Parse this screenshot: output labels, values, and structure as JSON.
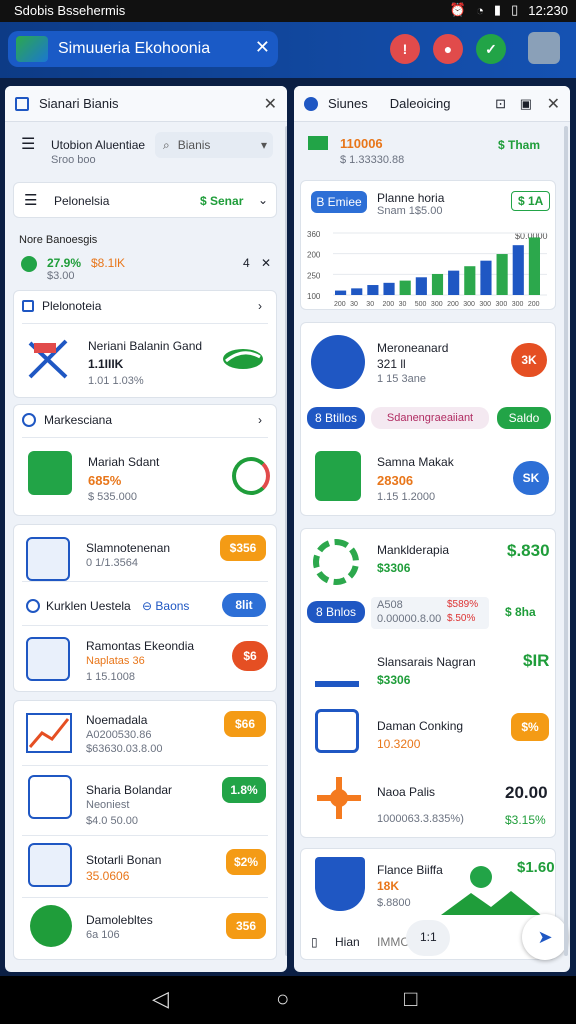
{
  "status": {
    "left": "Sdobis Bssehermis",
    "time": "12:230"
  },
  "appbar": {
    "title": "Simuueria Ekohoonia",
    "close": "✕"
  },
  "left": {
    "header": "Sianari Bianis",
    "row1": {
      "title": "Utobion Aluentiae",
      "sub": "Sroo boo",
      "search_placeholder": "Bianis"
    },
    "row2": {
      "title": "Pelonelsia",
      "value": "$ Senar"
    },
    "row3": {
      "title": "Nore Banoesgis",
      "pct": "27.9%",
      "sub1": "$3.00",
      "sub2": "$8.1lK",
      "right": "4"
    },
    "section1": {
      "title": "Plelonoteia",
      "item_title": "Neriani Balanin Gand",
      "item_value": "1.1IIIK",
      "item_sub": "1.01 1.03%"
    },
    "section2": {
      "title": "Markesciana",
      "item_title": "Mariah Sdant",
      "item_value": "685%",
      "item_sub": "$ 535.000"
    },
    "list": [
      {
        "title": "Slamnotenenan",
        "sub": "0 1/1.3564",
        "badge": "$356"
      },
      {
        "title": "Kurklen Uestela",
        "action": "Baons",
        "btn": "8lit"
      },
      {
        "title": "Ramontas Ekeondia",
        "sub": "Naplatas 36",
        "sub2": "1 15.1008",
        "badge": "$6"
      },
      {
        "title": "Noemadala",
        "sub": "A0200530.86",
        "sub2": "$63630.03.8.00",
        "badge": "$66"
      },
      {
        "title": "Sharia Bolandar",
        "sub": "Neoniest",
        "sub2": "$4.0 50.00",
        "badge": "1.8%"
      },
      {
        "title": "Stotarli Bonan",
        "sub": "35.0606",
        "badge": "$2%"
      },
      {
        "title": "Damolebltes",
        "sub": "6a 106",
        "badge": "356"
      }
    ]
  },
  "right": {
    "header1": "Siunes",
    "header2": "Daleoicing",
    "top": {
      "value": "110006",
      "sub": "$ 1.33330.88",
      "right": "$ Tham"
    },
    "chart": {
      "btn": "B Emiee",
      "title": "Planne horia",
      "sub": "Snam 1$5.00",
      "right": "$ 1A",
      "corner": "$0.0000"
    },
    "chart_data": {
      "type": "bar",
      "categories": [
        "200",
        "30",
        "30",
        "200",
        "30",
        "500",
        "300",
        "200",
        "300",
        "300",
        "300",
        "300",
        "200"
      ],
      "values": [
        20,
        30,
        45,
        55,
        65,
        80,
        95,
        110,
        130,
        155,
        185,
        225,
        260
      ],
      "ylabels": [
        "360",
        "200",
        "250",
        "100"
      ],
      "colors": [
        "#1f57c3",
        "#1f57c3",
        "#1f57c3",
        "#1f57c3",
        "#2ca84c",
        "#1f57c3",
        "#2ca84c",
        "#1f57c3",
        "#2ca84c",
        "#1f57c3",
        "#2ca84c",
        "#1f57c3",
        "#2ca84c"
      ]
    },
    "card2": {
      "title": "Meroneanard",
      "value": "321 ll",
      "sub": "1 15 3ane",
      "badge": "3K"
    },
    "chips": {
      "left": "8 Btillos",
      "mid": "Sdanengraeaiiant",
      "right": "Saldo"
    },
    "card3": {
      "title": "Samna Makak",
      "value": "28306",
      "sub": "1.15 1.2000",
      "badge": "SK"
    },
    "card4": {
      "title": "Manklderapia",
      "value": "$3306",
      "right": "$.830"
    },
    "chips2": {
      "left": "8 Bnlos",
      "mid1": "A508",
      "mid2": "0.00000.8.00",
      "v1": "$589%",
      "v2": "$.50%",
      "right": "$ 8ha"
    },
    "card5": {
      "title": "Slansarais Nagran",
      "value": "$3306",
      "right": "$IR"
    },
    "card6": {
      "title": "Daman Conking",
      "value": "10.3200",
      "badge": "$%"
    },
    "card7": {
      "title": "Naoa Palis",
      "sub": "1000063.3.835%)",
      "right": "20.00",
      "right2": "$3.15%"
    },
    "card8": {
      "title": "Flance Biiffa",
      "value": "18K",
      "sub": "$.8800",
      "right": "$1.60"
    },
    "footer": {
      "a": "Hian",
      "b": "IMMC",
      "c": "1:1"
    }
  }
}
